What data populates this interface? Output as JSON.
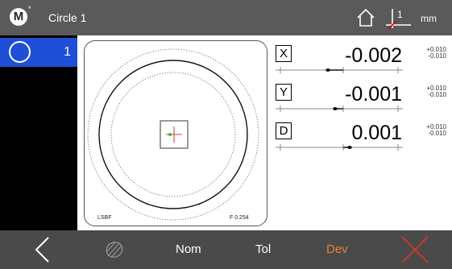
{
  "header": {
    "logo_letter": "M",
    "logo_mark": "*",
    "title": "Circle 1",
    "home_icon": "home-icon",
    "coord_icon": "coordinate-system-icon",
    "coord_number": "1",
    "unit": "mm"
  },
  "feature_list": {
    "items": [
      {
        "icon": "circle-icon",
        "number": "1",
        "selected": true
      }
    ]
  },
  "view": {
    "method": "LSBF",
    "f_value": "F 0.254",
    "point_color": "#22cc22",
    "crosshair_color": "#cc0000"
  },
  "results": [
    {
      "axis": "X",
      "value": "-0.002",
      "tol_upper": "+0.010",
      "tol_lower": "-0.010",
      "deviation": -0.002
    },
    {
      "axis": "Y",
      "value": "-0.001",
      "tol_upper": "+0.010",
      "tol_lower": "-0.010",
      "deviation": -0.001
    },
    {
      "axis": "D",
      "value": "0.001",
      "tol_upper": "+0.010",
      "tol_lower": "-0.010",
      "deviation": 0.001
    }
  ],
  "toolbar": {
    "back_icon": "chevron-left-icon",
    "probe_icon": "probe-icon",
    "nom_label": "Nom",
    "tol_label": "Tol",
    "dev_label": "Dev",
    "close_icon": "close-icon",
    "active_color": "#e8823a",
    "close_color": "#c0392b"
  }
}
